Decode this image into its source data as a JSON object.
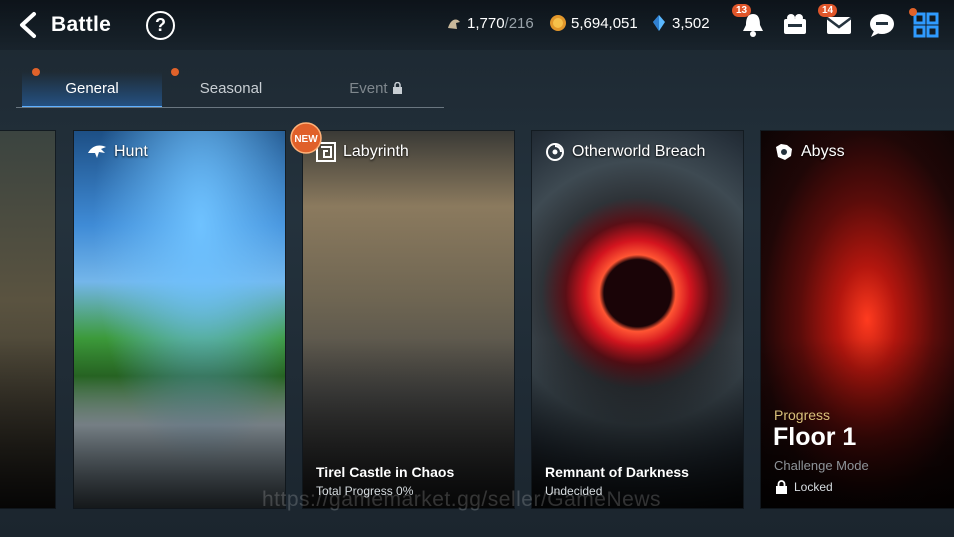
{
  "header": {
    "title": "Battle",
    "currencies": {
      "stamina": "1,770",
      "stamina_max": "/216",
      "gold": "5,694,051",
      "crystals": "3,502"
    },
    "badges": {
      "notifications": "13",
      "mail": "14"
    }
  },
  "tabs": [
    {
      "label": "General",
      "state": "active"
    },
    {
      "label": "Seasonal",
      "state": "normal"
    },
    {
      "label": "Event",
      "state": "locked"
    }
  ],
  "cards": {
    "hunt": {
      "title": "Hunt"
    },
    "labyrinth": {
      "title": "Labyrinth",
      "badge": "NEW",
      "subtitle": "Tirel Castle in Chaos",
      "detail": "Total Progress 0%"
    },
    "otherworld": {
      "title": "Otherworld Breach",
      "subtitle": "Remnant of Darkness",
      "detail": "Undecided"
    },
    "abyss": {
      "title": "Abyss",
      "progress_label": "Progress",
      "floor": "Floor 1",
      "mode": "Challenge Mode",
      "status": "Locked"
    }
  },
  "watermark": "https://gamemarket.gg/seller/GameNews",
  "colors": {
    "accent": "#5fb0ff",
    "badge": "#e0562a",
    "icon_blue": "#2f9bff"
  }
}
